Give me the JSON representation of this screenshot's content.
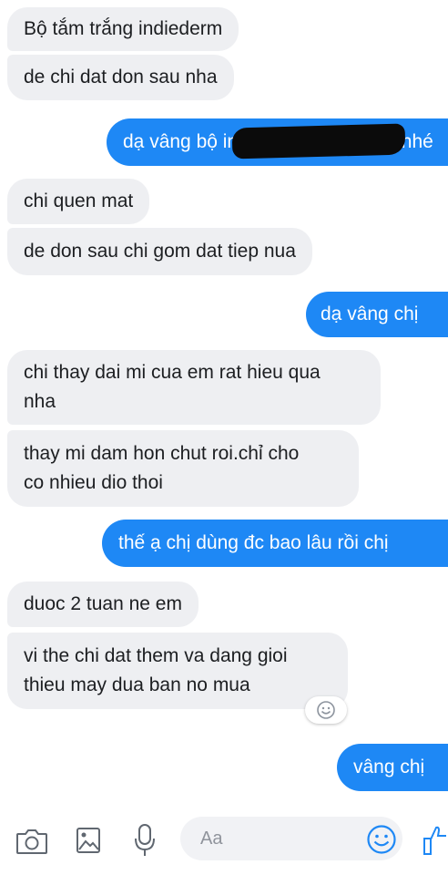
{
  "messages": [
    {
      "from": "them",
      "text": "Bộ tắm trắng indiederm"
    },
    {
      "from": "them",
      "text": "de chi dat don sau nha"
    },
    {
      "from": "me",
      "text_start": "dạ vâng bộ in",
      "text_end": "nhé"
    },
    {
      "from": "them",
      "text": "chi quen mat"
    },
    {
      "from": "them",
      "text": "de don sau chi gom dat tiep nua"
    },
    {
      "from": "me",
      "text": "dạ vâng chị"
    },
    {
      "from": "them",
      "line1": "chi thay dai mi cua em rat hieu qua",
      "line2": "nha"
    },
    {
      "from": "them",
      "line1": "thay mi dam hon chut roi.chỉ cho",
      "line2": "co nhieu dio thoi"
    },
    {
      "from": "me",
      "text": "thế ạ chị dùng đc bao lâu rồi chị"
    },
    {
      "from": "them",
      "text": "duoc 2 tuan ne em"
    },
    {
      "from": "them",
      "line1": "vi the chi dat them va dang gioi",
      "line2": "thieu may dua ban no mua"
    },
    {
      "from": "me",
      "text": "vâng chị"
    }
  ],
  "reaction": {
    "icon": "smile-reaction-icon"
  },
  "composer": {
    "placeholder": "Aa",
    "icons": [
      "camera-icon",
      "image-icon",
      "microphone-icon",
      "emoji-icon",
      "like-icon"
    ],
    "accent_color": "#1e88f5"
  },
  "colors": {
    "incoming_bubble": "#eeeff2",
    "outgoing_bubble": "#1e88f5"
  }
}
